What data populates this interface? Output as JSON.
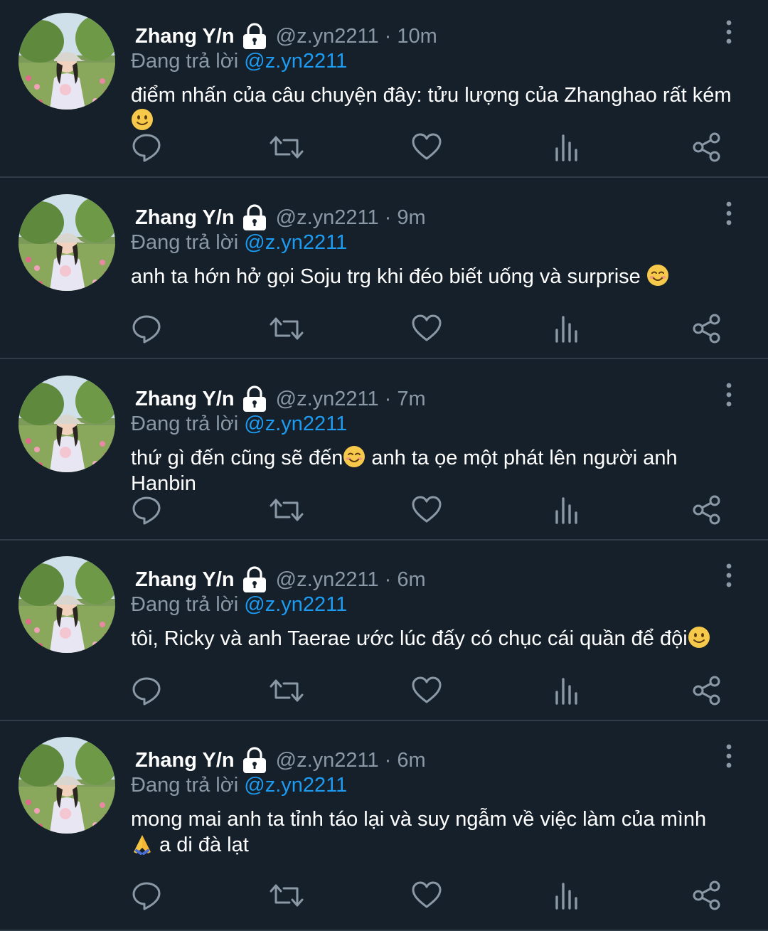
{
  "reply_prefix": "Đang trả lời",
  "tweets": [
    {
      "name": "Zhang Y/n",
      "handle": "@z.yn2211",
      "separator": "·",
      "time": "10m",
      "reply_to": "@z.yn2211",
      "text": "điểm nhấn của câu chuyện đây: tửu lượng của Zhanghao rất kém",
      "text_after_emoji": "",
      "emoji": "slightly-smiling-face"
    },
    {
      "name": "Zhang Y/n",
      "handle": "@z.yn2211",
      "separator": "·",
      "time": "9m",
      "reply_to": "@z.yn2211",
      "text": "anh ta hớn hở gọi Soju trg khi đéo biết uống và surprise ",
      "text_after_emoji": "",
      "emoji": "smiling-face-with-smiling-eyes"
    },
    {
      "name": "Zhang Y/n",
      "handle": "@z.yn2211",
      "separator": "·",
      "time": "7m",
      "reply_to": "@z.yn2211",
      "text": "thứ gì đến cũng sẽ đến",
      "text_after_emoji": " anh ta ọe một phát lên người anh Hanbin",
      "emoji": "smiling-face-with-smiling-eyes"
    },
    {
      "name": "Zhang Y/n",
      "handle": "@z.yn2211",
      "separator": "·",
      "time": "6m",
      "reply_to": "@z.yn2211",
      "text": "tôi, Ricky và anh Taerae ước lúc đấy có chục cái quần để đội",
      "text_after_emoji": "",
      "emoji": "slightly-smiling-face"
    },
    {
      "name": "Zhang Y/n",
      "handle": "@z.yn2211",
      "separator": "·",
      "time": "6m",
      "reply_to": "@z.yn2211",
      "text": "mong mai anh ta tỉnh táo lại và suy ngẫm về việc làm của mình",
      "text_line2": " a di đà lạt",
      "emoji": "folded-hands"
    }
  ],
  "icons": {
    "reply": "reply-icon",
    "retweet": "retweet-icon",
    "like": "heart-icon",
    "views": "views-icon",
    "share": "share-icon",
    "more": "more-vertical-icon",
    "lock": "lock-icon"
  },
  "colors": {
    "background": "#15202b",
    "secondary_text": "#8b98a5",
    "link": "#1d9bf0",
    "divider": "#2f3b47"
  }
}
